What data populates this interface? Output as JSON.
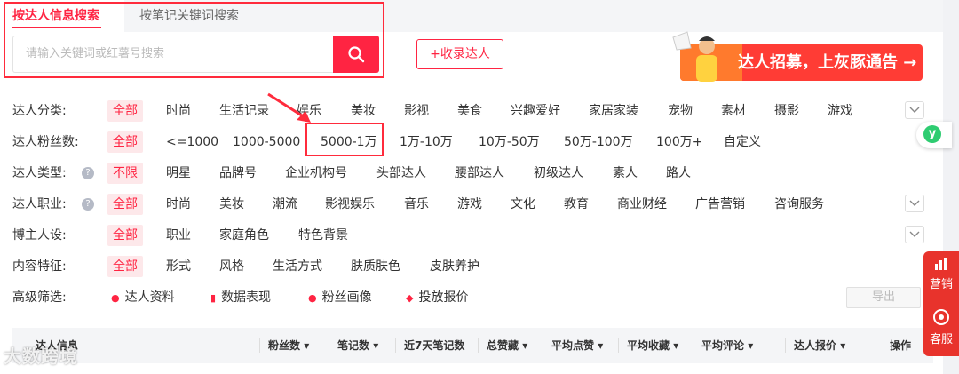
{
  "tabs": [
    {
      "label": "按达人信息搜索"
    },
    {
      "label": "按笔记关键词搜索"
    }
  ],
  "search": {
    "placeholder": "请输入关键词或红薯号搜索"
  },
  "collect_button": "+收录达人",
  "banner": {
    "text": "达人招募，上灰豚通告 →"
  },
  "filters": [
    {
      "label": "达人分类:",
      "options": [
        "全部",
        "时尚",
        "生活记录",
        "娱乐",
        "美妆",
        "影视",
        "美食",
        "兴趣爱好",
        "家居家装",
        "宠物",
        "素材",
        "摄影",
        "游戏"
      ]
    },
    {
      "label": "达人粉丝数:",
      "options": [
        "全部",
        "<=1000",
        "1000-5000",
        "5000-1万",
        "1万-10万",
        "10万-50万",
        "50万-100万",
        "100万+",
        "自定义"
      ]
    },
    {
      "label": "达人类型:",
      "options": [
        "不限",
        "明星",
        "品牌号",
        "企业机构号",
        "头部达人",
        "腰部达人",
        "初级达人",
        "素人",
        "路人"
      ]
    },
    {
      "label": "达人职业:",
      "options": [
        "全部",
        "时尚",
        "美妆",
        "潮流",
        "影视娱乐",
        "音乐",
        "游戏",
        "文化",
        "教育",
        "商业财经",
        "广告营销",
        "咨询服务"
      ]
    },
    {
      "label": "博主人设:",
      "options": [
        "全部",
        "职业",
        "家庭角色",
        "特色背景"
      ]
    },
    {
      "label": "内容特征:",
      "options": [
        "全部",
        "形式",
        "风格",
        "生活方式",
        "肤质肤色",
        "皮肤养护"
      ]
    }
  ],
  "advanced": {
    "label": "高级筛选:",
    "options": [
      "达人资料",
      "数据表现",
      "粉丝画像",
      "投放报价"
    ],
    "export": "导出"
  },
  "table_headers": [
    "达人信息",
    "粉丝数",
    "笔记数",
    "近7天笔记数",
    "总赞藏",
    "平均点赞",
    "平均收藏",
    "平均评论",
    "达人报价",
    "操作"
  ],
  "side": {
    "marketing": "营销",
    "service": "客服",
    "badge": "y"
  },
  "watermark": "大数跨境",
  "colors": {
    "accent": "#ff2442",
    "highlight_box": "#ff2b3c"
  }
}
